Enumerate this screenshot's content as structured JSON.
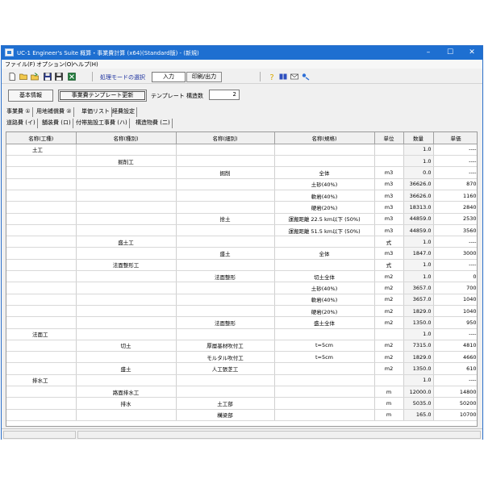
{
  "window": {
    "title": "UC-1 Engineer's Suite 概算・事業費計算 (x64)(Standard版) - (新規)",
    "minimize": "–",
    "maximize": "☐",
    "close": "✕"
  },
  "menu": {
    "file": "ファイル(F)",
    "options": "オプション(O)",
    "help": "ヘルプ(H)"
  },
  "toolbar": {
    "mode_label": "処理モードの選択",
    "input_label": "入力",
    "print_label": "印刷/出力",
    "icons": [
      "new-file-icon",
      "open-folder-icon",
      "open-recent-icon",
      "save-icon",
      "save-as-icon",
      "excel-icon",
      "help-icon",
      "book-icon",
      "mail-icon",
      "update-icon"
    ]
  },
  "subbar": {
    "basic_info": "基本情報",
    "template_update": "事業費テンプレート更新",
    "template_label": "テンプレート 構造数",
    "template_count": "2"
  },
  "tabs_main": [
    "事業費 ①",
    "用地補償費 ②",
    "単価リスト",
    "経費設定"
  ],
  "tabs_sub": [
    "道路費 (イ)",
    "舗装費 (ロ)",
    "付帯施設工事費 (ハ)",
    "構造物費 (二)"
  ],
  "table": {
    "headers": [
      "名称(工種)",
      "名称(種別)",
      "名称(細別)",
      "名称(規格)",
      "単位",
      "数量",
      "単価"
    ],
    "rows": [
      [
        "土工",
        "",
        "",
        "",
        "",
        "1.0",
        "----"
      ],
      [
        "",
        "掘削工",
        "",
        "",
        "",
        "1.0",
        "----"
      ],
      [
        "",
        "",
        "掘削",
        "全体",
        "m3",
        "0.0",
        "----"
      ],
      [
        "",
        "",
        "",
        "土砂(40%)",
        "m3",
        "36626.0",
        "870"
      ],
      [
        "",
        "",
        "",
        "軟岩(40%)",
        "m3",
        "36626.0",
        "1160"
      ],
      [
        "",
        "",
        "",
        "硬岩(20%)",
        "m3",
        "18313.0",
        "2840"
      ],
      [
        "",
        "",
        "捨土",
        "運搬距離 22.5 km以下 (50%)",
        "m3",
        "44859.0",
        "2530"
      ],
      [
        "",
        "",
        "",
        "運搬距離 51.5 km以下 (50%)",
        "m3",
        "44859.0",
        "3560"
      ],
      [
        "",
        "盛土工",
        "",
        "",
        "式",
        "1.0",
        "----"
      ],
      [
        "",
        "",
        "盛土",
        "全体",
        "m3",
        "1847.0",
        "3000"
      ],
      [
        "",
        "法面整形工",
        "",
        "",
        "式",
        "1.0",
        "----"
      ],
      [
        "",
        "",
        "法面整形",
        "切土全体",
        "m2",
        "1.0",
        "0"
      ],
      [
        "",
        "",
        "",
        "土砂(40%)",
        "m2",
        "3657.0",
        "700"
      ],
      [
        "",
        "",
        "",
        "軟岩(40%)",
        "m2",
        "3657.0",
        "1040"
      ],
      [
        "",
        "",
        "",
        "硬岩(20%)",
        "m2",
        "1829.0",
        "1040"
      ],
      [
        "",
        "",
        "法面整形",
        "盛土全体",
        "m2",
        "1350.0",
        "950"
      ],
      [
        "法面工",
        "",
        "",
        "",
        "",
        "1.0",
        "----"
      ],
      [
        "",
        "切土",
        "厚層基材吹付工",
        "t=5cm",
        "m2",
        "7315.0",
        "4810"
      ],
      [
        "",
        "",
        "モルタル吹付工",
        "t=5cm",
        "m2",
        "1829.0",
        "4660"
      ],
      [
        "",
        "盛土",
        "人工張芝工",
        "",
        "m2",
        "1350.0",
        "610"
      ],
      [
        "排水工",
        "",
        "",
        "",
        "",
        "1.0",
        "----"
      ],
      [
        "",
        "路面排水工",
        "",
        "",
        "m",
        "12000.0",
        "14800"
      ],
      [
        "",
        "排水",
        "土工部",
        "",
        "m",
        "5035.0",
        "50200"
      ],
      [
        "",
        "",
        "構梁部",
        "",
        "m",
        "165.0",
        "10700"
      ]
    ]
  },
  "colors": {
    "titlebar": "#1e6fd1",
    "mode_label": "#1a2f9e"
  }
}
